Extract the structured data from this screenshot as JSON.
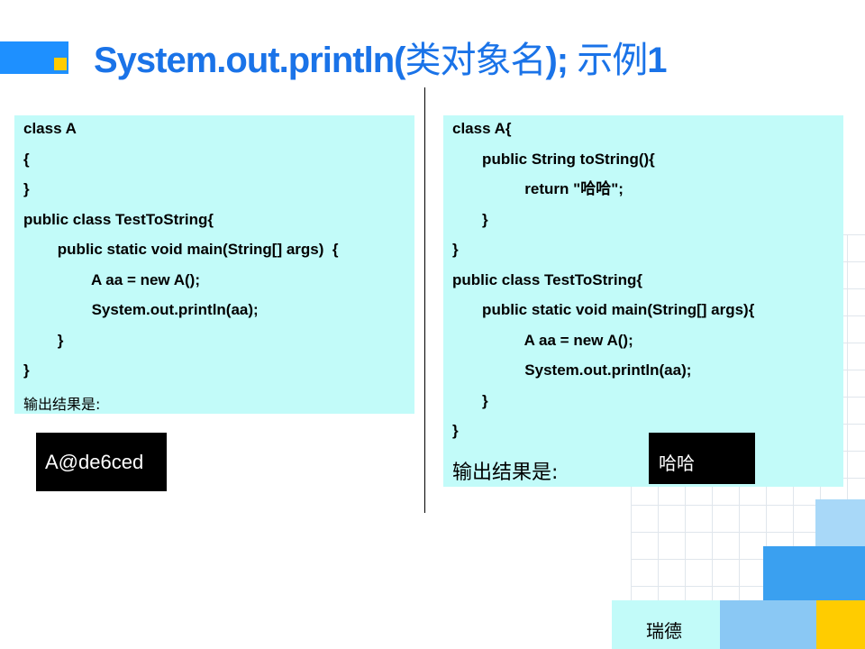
{
  "title": {
    "text_latin_start": "System.out.println(",
    "text_cn_1": "类对象名",
    "text_latin_mid": ");  ",
    "text_cn_2": "示例",
    "text_latin_end": "1"
  },
  "left": {
    "code_lines": [
      "class A",
      "{",
      "}",
      "public class TestToString{",
      "        public static void main(String[] args)  {",
      "                A aa = new A();",
      "                System.out.println(aa);",
      "        }",
      "}"
    ],
    "output_label": "输出结果是:",
    "output_value": "A@de6ced"
  },
  "right": {
    "code_lines": [
      "class A{",
      "       public String toString(){",
      "                 return \"哈哈\";",
      "       }",
      "}",
      "public class TestToString{",
      "       public static void main(String[] args){",
      "                 A aa = new A();",
      "                 System.out.println(aa);",
      "       }",
      "}"
    ],
    "output_label": "输出结果是:",
    "output_value": "哈哈"
  },
  "footer": {
    "text": "瑞德"
  },
  "colors": {
    "title": "#1a73e8",
    "code_bg": "#c2fbf9",
    "accent_blue": "#1e90ff",
    "accent_yellow": "#ffcc00"
  }
}
